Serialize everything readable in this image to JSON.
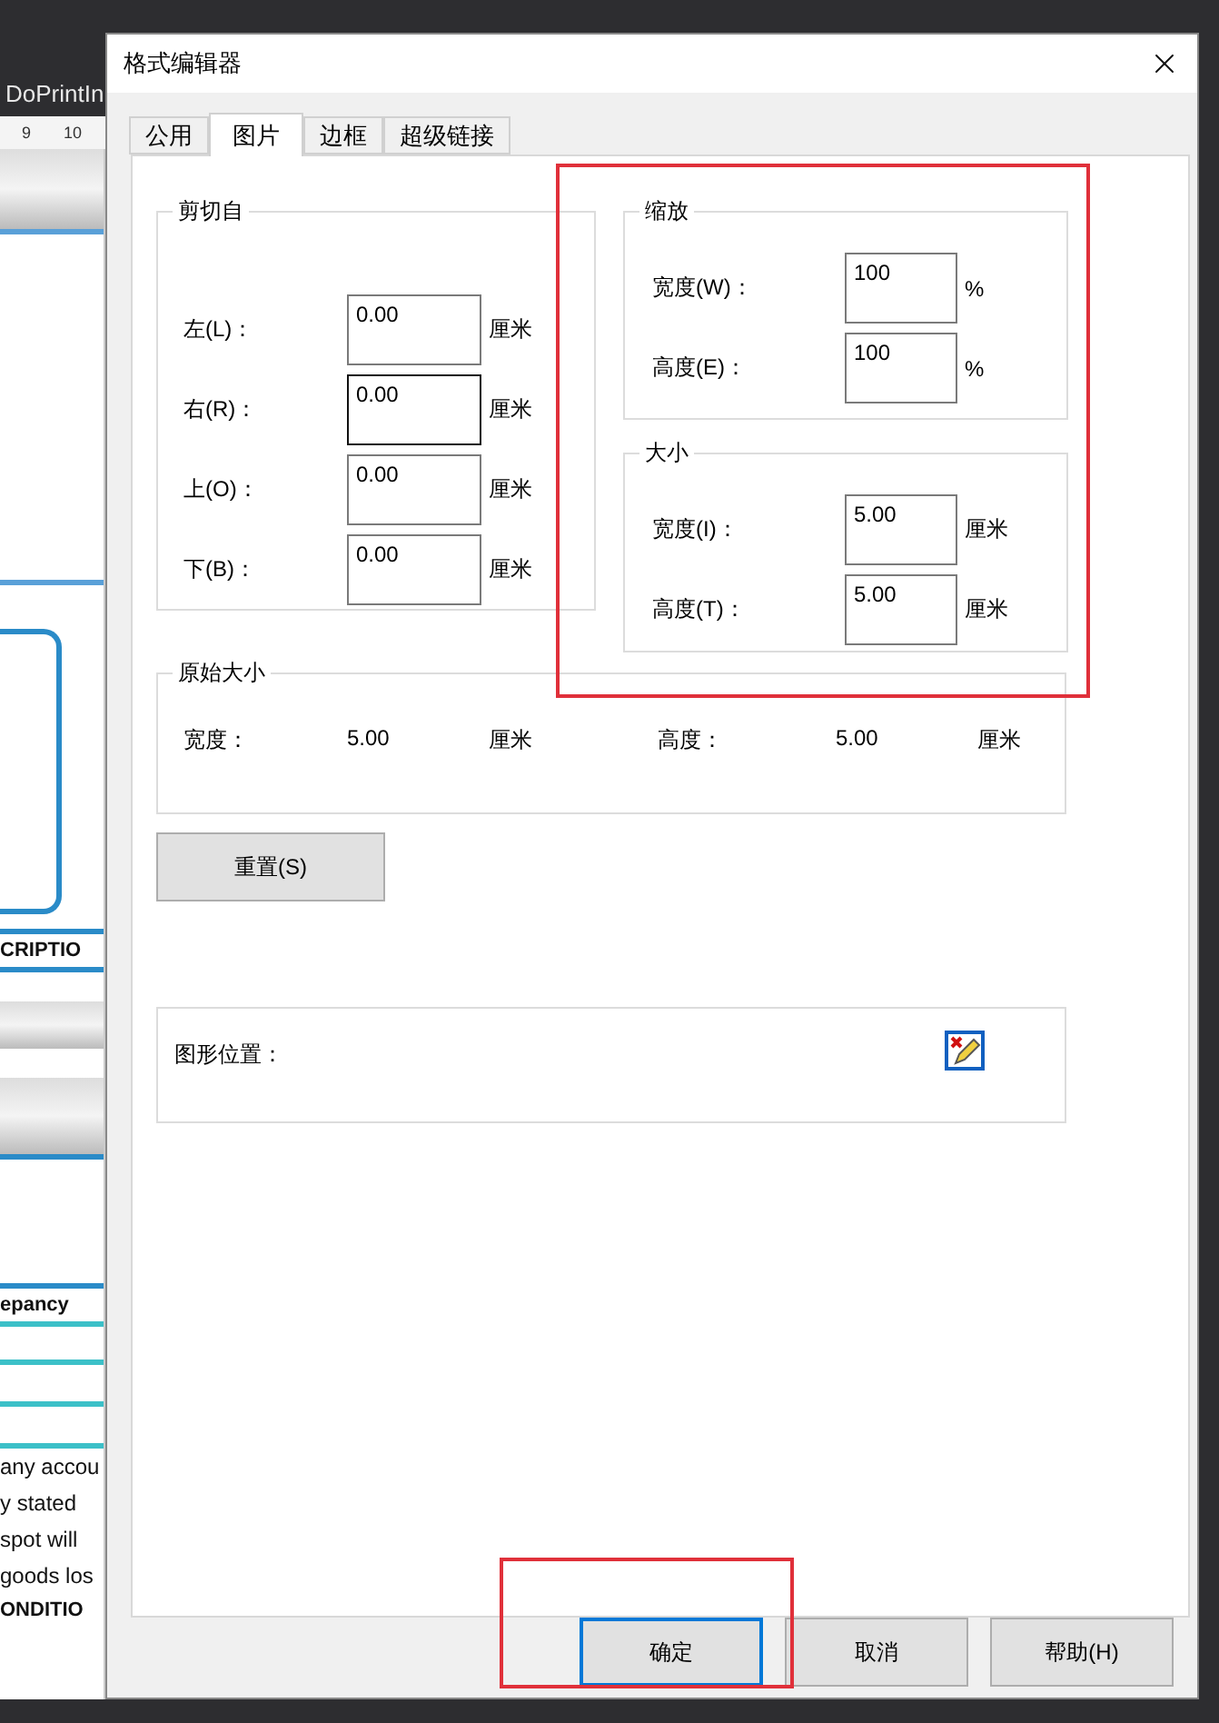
{
  "background": {
    "document_title": "DoPrintIn",
    "ruler_labels": [
      "9",
      "10"
    ],
    "heading_top": "CRIPTIO",
    "heading_mid": "epancy",
    "body_lines": [
      "any accou",
      "y stated",
      "spot will",
      "goods los"
    ],
    "heading_bottom": "ONDITIO"
  },
  "dialog": {
    "title": "格式编辑器",
    "tabs": [
      {
        "label": "公用",
        "selected": false
      },
      {
        "label": "图片",
        "selected": true
      },
      {
        "label": "边框",
        "selected": false
      },
      {
        "label": "超级链接",
        "selected": false
      }
    ],
    "crop_group": {
      "title": "剪切自",
      "fields": [
        {
          "label": "左(L)：",
          "value": "0.00",
          "unit": "厘米",
          "focused": false
        },
        {
          "label": "右(R)：",
          "value": "0.00",
          "unit": "厘米",
          "focused": true
        },
        {
          "label": "上(O)：",
          "value": "0.00",
          "unit": "厘米",
          "focused": false
        },
        {
          "label": "下(B)：",
          "value": "0.00",
          "unit": "厘米",
          "focused": false
        }
      ]
    },
    "scale_group": {
      "title": "缩放",
      "fields": [
        {
          "label": "宽度(W)：",
          "value": "100",
          "unit": "%",
          "focused": false
        },
        {
          "label": "高度(E)：",
          "value": "100",
          "unit": "%",
          "focused": false
        }
      ]
    },
    "size_group": {
      "title": "大小",
      "fields": [
        {
          "label": "宽度(I)：",
          "value": "5.00",
          "unit": "厘米",
          "focused": false
        },
        {
          "label": "高度(T)：",
          "value": "5.00",
          "unit": "厘米",
          "focused": false
        }
      ]
    },
    "original_size": {
      "title": "原始大小",
      "items": [
        {
          "label": "宽度：",
          "value": "5.00",
          "unit": "厘米"
        },
        {
          "label": "高度：",
          "value": "5.00",
          "unit": "厘米"
        }
      ]
    },
    "reset_button": "重置(S)",
    "position_group": {
      "label": "图形位置："
    },
    "buttons": [
      {
        "label": "确定",
        "default": true
      },
      {
        "label": "取消",
        "default": false
      },
      {
        "label": "帮助(H)",
        "default": false
      }
    ]
  }
}
